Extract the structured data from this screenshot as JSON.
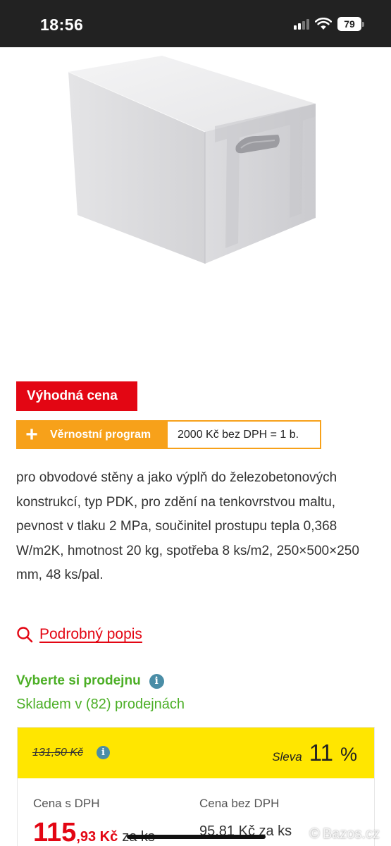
{
  "status_bar": {
    "time": "18:56",
    "battery": "79"
  },
  "product": {
    "image_icon": "aerated-concrete-block-image",
    "badge": "Výhodná cena",
    "loyalty": {
      "icon": "plus-icon",
      "label": "Věrnostní program",
      "value": "2000 Kč bez DPH = 1 b."
    },
    "description": "pro obvodové stěny a jako výplň do železobetonových konstrukcí, typ PDK, pro zdění na tenkovrstvou maltu, pevnost v tlaku 2 MPa, součinitel prostupu tepla 0,368 W/m2K, hmotnost 20 kg, spotřeba 8 ks/m2, 250×500×250 mm, 48 ks/pal.",
    "detail_link": "Podrobný popis"
  },
  "store": {
    "title": "Vyberte si prodejnu",
    "stock": "Skladem v (82) prodejnách"
  },
  "price": {
    "old": "131,50 Kč",
    "discount_label": "Sleva",
    "discount_value": "11",
    "discount_unit": "%",
    "with_vat_label": "Cena s DPH",
    "with_vat_int": "115",
    "with_vat_dec": ",93 Kč",
    "with_vat_unit": "za ks",
    "without_vat_label": "Cena bez DPH",
    "without_vat": "95,81 Kč za ks"
  },
  "watermark": "Bazos.cz",
  "colors": {
    "brand_red": "#e30613",
    "loyalty_orange": "#f7a11a",
    "stock_green": "#4caf26",
    "price_yellow": "#ffe600",
    "info_blue": "#4a8da6"
  }
}
